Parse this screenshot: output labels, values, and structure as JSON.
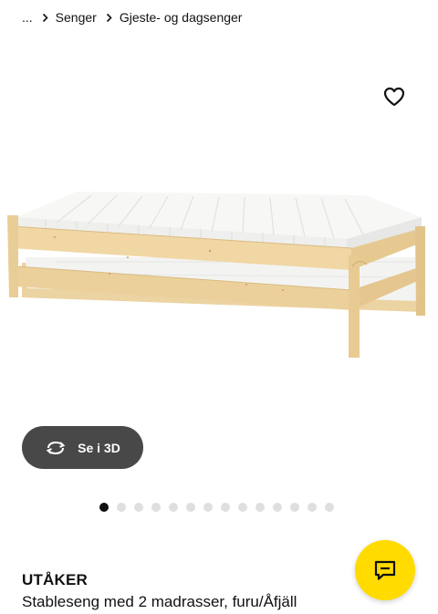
{
  "breadcrumb": {
    "ellipsis": "...",
    "items": [
      {
        "label": "Senger"
      },
      {
        "label": "Gjeste- og dagsenger"
      }
    ]
  },
  "view_3d": {
    "label": "Se i 3D"
  },
  "gallery": {
    "total_images": 14,
    "active_index": 0
  },
  "product": {
    "name": "UTÅKER",
    "description": "Stableseng med 2 madrasser, furu/Åfjäll"
  },
  "icons": {
    "favorite": "heart-outline-icon",
    "rotate": "rotate-3d-icon",
    "chat": "chat-bubble-icon",
    "chevron": "chevron-right-icon"
  },
  "colors": {
    "accent_yellow": "#ffdb00",
    "dark_button": "#484848",
    "active_dot": "#111111",
    "inactive_dot": "#dfdfdf"
  }
}
